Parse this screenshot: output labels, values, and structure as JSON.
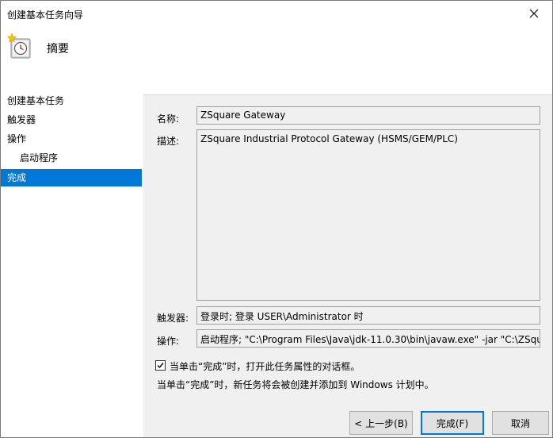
{
  "window": {
    "title": "创建基本任务向导"
  },
  "header": {
    "title": "摘要"
  },
  "sidebar": {
    "items": [
      {
        "label": "创建基本任务"
      },
      {
        "label": "触发器"
      },
      {
        "label": "操作"
      },
      {
        "label": "启动程序"
      },
      {
        "label": "完成"
      }
    ]
  },
  "summary": {
    "name_label": "名称:",
    "name_value": "ZSquare Gateway",
    "desc_label": "描述:",
    "desc_value": "ZSquare Industrial Protocol Gateway (HSMS/GEM/PLC)",
    "trigger_label": "触发器:",
    "trigger_value": "登录时; 登录 USER\\Administrator 时",
    "action_label": "操作:",
    "action_value": "启动程序; \"C:\\Program Files\\Java\\jdk-11.0.30\\bin\\javaw.exe\" -jar \"C:\\ZSqua"
  },
  "options": {
    "open_properties_label": "当单击“完成”时，打开此任务属性的对话框。",
    "open_properties_checked": true,
    "note": "当单击“完成”时，新任务将会被创建并添加到 Windows 计划中。"
  },
  "buttons": {
    "back": "< 上一步(B)",
    "finish": "完成(F)",
    "cancel": "取消"
  },
  "icons": {
    "close": "close-icon",
    "header": "task-clock-icon",
    "checkbox": "checkmark-icon"
  }
}
